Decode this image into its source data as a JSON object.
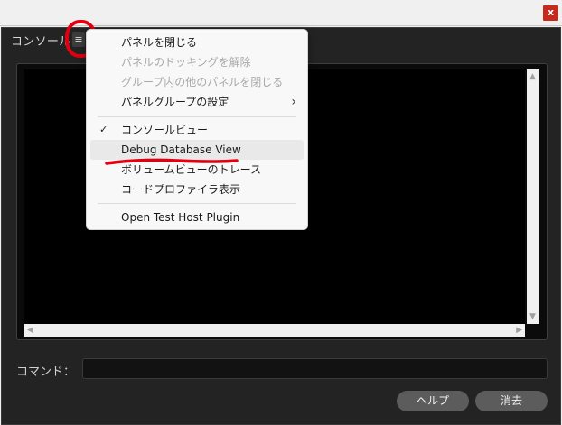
{
  "window": {
    "close_icon": "x"
  },
  "panel": {
    "title": "コンソール",
    "menu_icon": "≡",
    "command_label": "コマンド：",
    "command_value": "",
    "help_label": "ヘルプ",
    "clear_label": "消去"
  },
  "menu": {
    "items": [
      {
        "label": "パネルを閉じる",
        "enabled": true
      },
      {
        "label": "パネルのドッキングを解除",
        "enabled": false
      },
      {
        "label": "グループ内の他のパネルを閉じる",
        "enabled": false
      },
      {
        "label": "パネルグループの設定",
        "enabled": true,
        "submenu": true
      },
      {
        "label": "コンソールビュー",
        "enabled": true,
        "checked": true
      },
      {
        "label": "Debug Database View",
        "enabled": true,
        "highlighted": true
      },
      {
        "label": "ボリュームビューのトレース",
        "enabled": true
      },
      {
        "label": "コードプロファイラ表示",
        "enabled": true
      },
      {
        "label": "Open Test Host Plugin",
        "enabled": true
      }
    ],
    "check_glyph": "✓",
    "chevron_glyph": "›"
  },
  "colors": {
    "annotation_red": "#e00012",
    "panel_bg": "#232323",
    "button_bg": "#5c5c5c"
  }
}
